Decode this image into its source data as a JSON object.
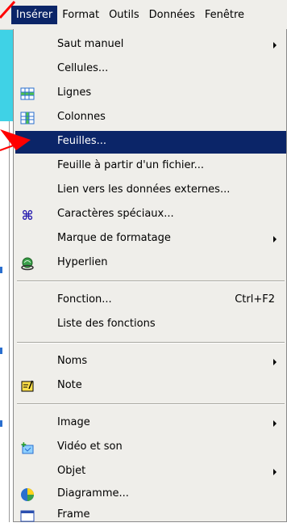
{
  "menubar": {
    "items": [
      "Insérer",
      "Format",
      "Outils",
      "Données",
      "Fenêtre"
    ]
  },
  "menu": {
    "items": [
      {
        "label": "Saut manuel",
        "icon": "",
        "submenu": true
      },
      {
        "label": "Cellules...",
        "icon": "",
        "submenu": false
      },
      {
        "label": "Lignes",
        "icon": "insert-rows-icon",
        "submenu": false
      },
      {
        "label": "Colonnes",
        "icon": "insert-columns-icon",
        "submenu": false
      },
      {
        "label": "Feuilles...",
        "icon": "",
        "submenu": false,
        "highlighted": true
      },
      {
        "label": "Feuille à partir d'un fichier...",
        "icon": "",
        "submenu": false
      },
      {
        "label": "Lien vers les données externes...",
        "icon": "",
        "submenu": false
      },
      {
        "label": "Caractères spéciaux...",
        "icon": "special-character-icon",
        "submenu": false
      },
      {
        "label": "Marque de formatage",
        "icon": "",
        "submenu": true
      },
      {
        "label": "Hyperlien",
        "icon": "hyperlink-icon",
        "submenu": false
      },
      {
        "label": "Fonction...",
        "icon": "",
        "shortcut": "Ctrl+F2",
        "submenu": false
      },
      {
        "label": "Liste des fonctions",
        "icon": "",
        "submenu": false
      },
      {
        "label": "Noms",
        "icon": "",
        "submenu": true
      },
      {
        "label": "Note",
        "icon": "note-icon",
        "submenu": false
      },
      {
        "label": "Image",
        "icon": "",
        "submenu": true
      },
      {
        "label": "Vidéo et son",
        "icon": "video-sound-icon",
        "submenu": false
      },
      {
        "label": "Objet",
        "icon": "",
        "submenu": true
      },
      {
        "label": "Diagramme...",
        "icon": "chart-icon",
        "submenu": false
      },
      {
        "label": "Frame",
        "icon": "frame-icon",
        "submenu": false
      }
    ]
  },
  "colors": {
    "menu_bg": "#efeeea",
    "highlight": "#0b2568",
    "annotation": "#ff0000"
  }
}
